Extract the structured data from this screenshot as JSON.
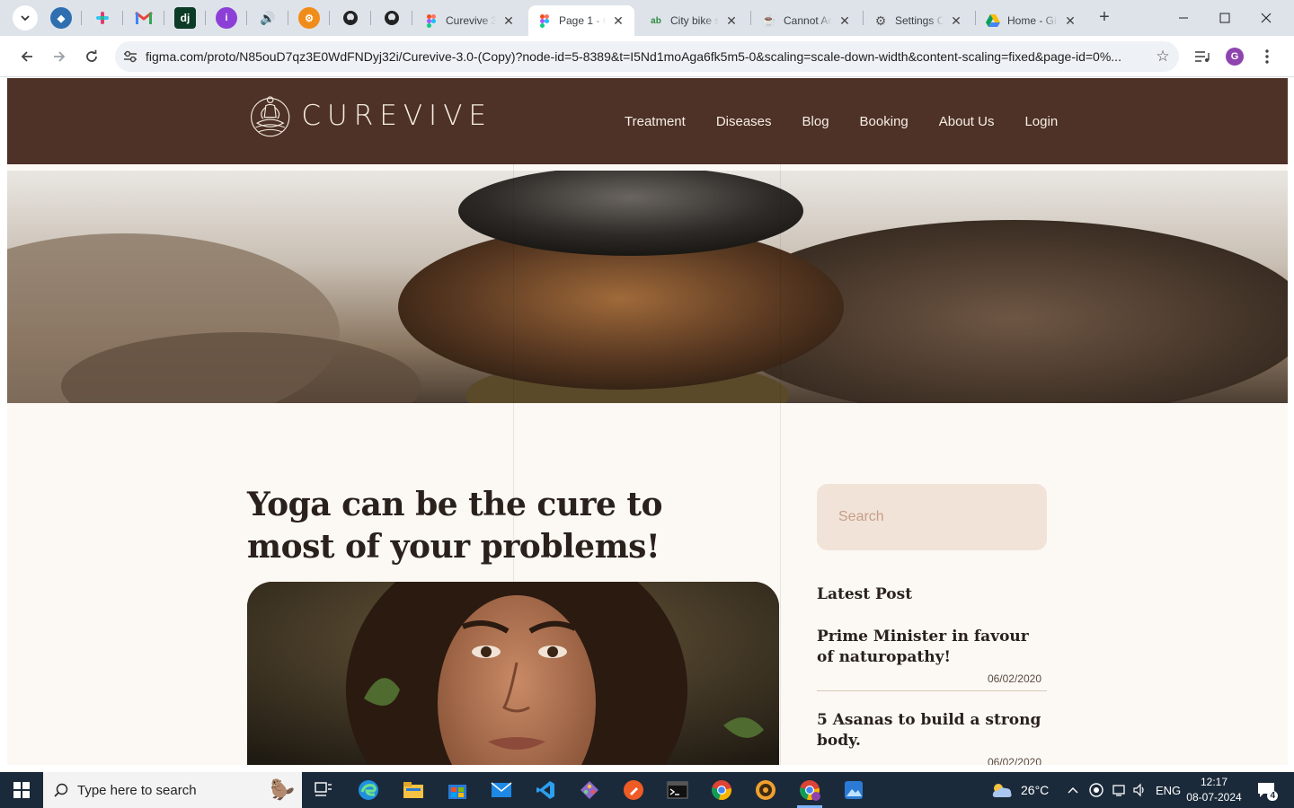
{
  "browser": {
    "tabs": [
      {
        "title": "Curevive 3",
        "active": false
      },
      {
        "title": "Page 1 - C",
        "active": true
      },
      {
        "title": "City bike s",
        "active": false
      },
      {
        "title": "Cannot Ac",
        "active": false
      },
      {
        "title": "Settings C",
        "active": false
      },
      {
        "title": "Home - Gi",
        "active": false
      }
    ],
    "url": "figma.com/proto/N85ouD7qz3E0WdFNDyj32i/Curevive-3.0-(Copy)?node-id=5-8389&t=I5Nd1moAga6fk5m5-0&scaling=scale-down-width&content-scaling=fixed&page-id=0%...",
    "profile_initial": "G"
  },
  "site": {
    "brand": "CUREVIVE",
    "nav": [
      "Treatment",
      "Diseases",
      "Blog",
      "Booking",
      "About Us",
      "Login"
    ],
    "headline": "Yoga can be the cure to most of your problems!",
    "search_placeholder": "Search",
    "latest_heading": "Latest Post",
    "posts": [
      {
        "title": "Prime Minister in favour of naturopathy!",
        "date": "06/02/2020"
      },
      {
        "title": "5 Asanas to build a strong body.",
        "date": "06/02/2020"
      }
    ],
    "colors": {
      "header": "#4e3127",
      "background": "#fcf9f5",
      "search_bg": "#f2e3d8",
      "accent": "#c49f87"
    }
  },
  "taskbar": {
    "search_placeholder": "Type here to search",
    "weather": "26°C",
    "language": "ENG",
    "time": "12:17",
    "date": "08-07-2024",
    "notification_count": "4"
  }
}
